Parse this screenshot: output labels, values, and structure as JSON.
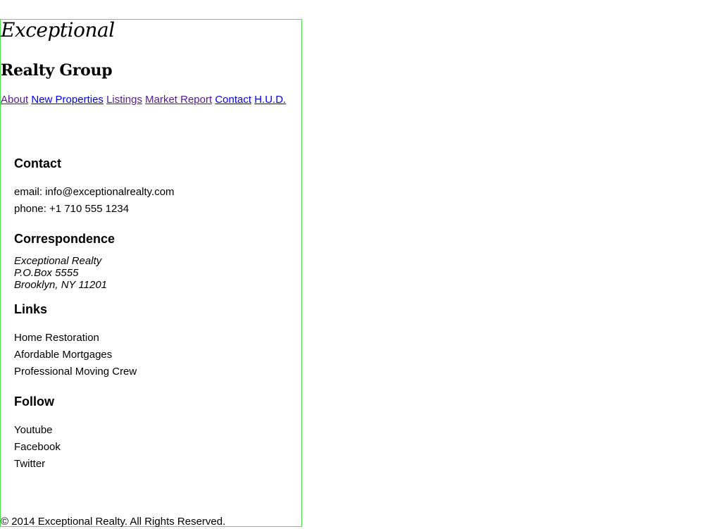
{
  "brand": {
    "line1": "Exceptional",
    "line2": "Realty Group"
  },
  "nav": {
    "items": [
      {
        "label": "About"
      },
      {
        "label": "New Properties"
      },
      {
        "label": "Listings"
      },
      {
        "label": "Market Report"
      },
      {
        "label": "Contact"
      },
      {
        "label": "H.U.D."
      }
    ]
  },
  "contact": {
    "heading": "Contact",
    "email": "email: info@exceptionalrealty.com",
    "phone": "phone: +1 710 555 1234"
  },
  "correspondence": {
    "heading": "Correspondence",
    "lines": [
      "Exceptional Realty",
      "P.O.Box 5555",
      "Brooklyn, NY 11201"
    ]
  },
  "links": {
    "heading": "Links",
    "items": [
      "Home Restoration",
      "Afordable Mortgages",
      "Professional Moving Crew"
    ]
  },
  "follow": {
    "heading": "Follow",
    "items": [
      "Youtube",
      "Facebook",
      "Twitter"
    ]
  },
  "footer": {
    "copyright": "© 2014 Exceptional Realty. All Rights Reserved."
  },
  "colors": {
    "link": "#0000ee",
    "visited_link": "#551a8b",
    "outline": "#4be34b",
    "text": "#000000"
  }
}
